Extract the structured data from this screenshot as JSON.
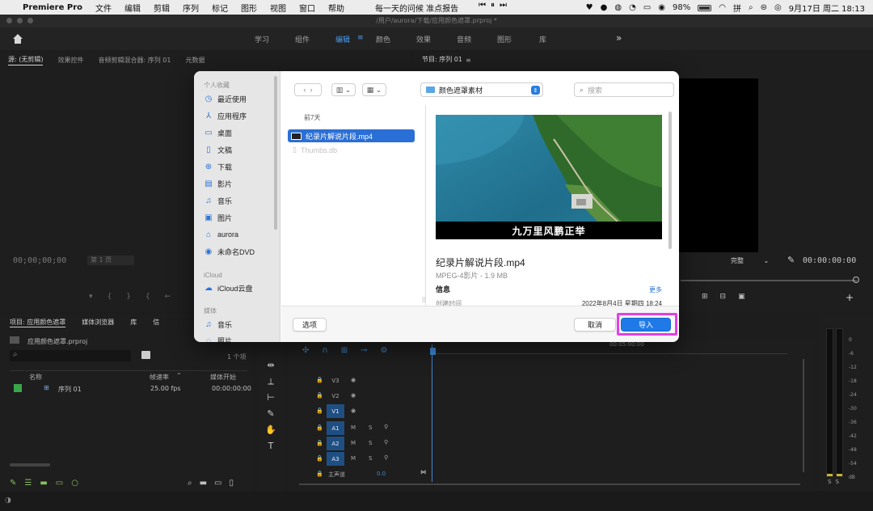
{
  "menubar": {
    "app_name": "Premiere Pro",
    "menus": [
      "文件",
      "编辑",
      "剪辑",
      "序列",
      "标记",
      "图形",
      "视图",
      "窗口",
      "帮助"
    ],
    "center_text": "每一天的问候 准点报告",
    "battery_percent": "98%",
    "input_method": "拼",
    "datetime": "9月17日 周二 18:13",
    "battery_level": 0.98
  },
  "window": {
    "path": "/用户/aurora/下载/应用颜色遮罩.prproj *"
  },
  "workspaces": {
    "items": [
      "学习",
      "组件",
      "编辑",
      "颜色",
      "效果",
      "音频",
      "图形",
      "库"
    ],
    "active": "编辑",
    "more": "»"
  },
  "source_panel": {
    "tabs": [
      "源: (无剪辑)",
      "效果控件",
      "音频剪辑混合器: 序列 01",
      "元数据"
    ],
    "timecode": "00;00;00;00",
    "page": "第 1 页"
  },
  "program_panel": {
    "title": "节目: 序列 01",
    "fit": "完整",
    "timecode": "00:00:00:00"
  },
  "project_panel": {
    "tabs": [
      "项目: 应用颜色遮罩",
      "媒体浏览器",
      "库",
      "信"
    ],
    "file": "应用颜色遮罩.prproj",
    "count": "1 个项",
    "columns": [
      "名称",
      "帧速率",
      "媒体开始"
    ],
    "rows": [
      {
        "name": "序列 01",
        "fps": "25.00 fps",
        "start": "00:00:00:00"
      }
    ]
  },
  "timeline": {
    "ruler_mark": "00:05:00:00",
    "tracks": [
      {
        "name": "V3",
        "active": false
      },
      {
        "name": "V2",
        "active": false
      },
      {
        "name": "V1",
        "active": true
      },
      {
        "name": "A1",
        "active": true
      },
      {
        "name": "A2",
        "active": true
      },
      {
        "name": "A3",
        "active": true
      }
    ],
    "master_label": "主声道",
    "master_value": "0.0"
  },
  "meter": {
    "scale": [
      "0",
      "-6",
      "-12",
      "-18",
      "-24",
      "-30",
      "-36",
      "-42",
      "-48",
      "-54",
      "dB"
    ],
    "solo": [
      "S",
      "S"
    ]
  },
  "dialog": {
    "sidebar": {
      "favorites_heading": "个人收藏",
      "favorites": [
        {
          "icon": "clock-icon",
          "label": "最近使用"
        },
        {
          "icon": "apps-icon",
          "label": "应用程序"
        },
        {
          "icon": "desktop-icon",
          "label": "桌面"
        },
        {
          "icon": "document-icon",
          "label": "文稿"
        },
        {
          "icon": "download-icon",
          "label": "下载"
        },
        {
          "icon": "film-icon",
          "label": "影片"
        },
        {
          "icon": "music-icon",
          "label": "音乐"
        },
        {
          "icon": "photo-icon",
          "label": "图片"
        },
        {
          "icon": "home-icon",
          "label": "aurora"
        },
        {
          "icon": "disc-icon",
          "label": "未命名DVD"
        }
      ],
      "icloud_heading": "iCloud",
      "icloud": [
        {
          "icon": "cloud-icon",
          "label": "iCloud云盘"
        }
      ],
      "media_heading": "媒体",
      "media": [
        {
          "icon": "music-icon",
          "label": "音乐"
        },
        {
          "icon": "camera-icon",
          "label": "照片"
        }
      ]
    },
    "location": "颜色遮罩素材",
    "search_placeholder": "搜索",
    "list_heading": "前7天",
    "files": [
      {
        "name": "纪录片解说片段.mp4",
        "selected": true
      },
      {
        "name": "Thumbs.db",
        "selected": false
      }
    ],
    "preview": {
      "caption": "九万里风鹏正举",
      "name": "纪录片解说片段.mp4",
      "kind": "MPEG-4影片 - 1.9 MB",
      "info_heading": "信息",
      "more": "更多",
      "created_label": "创建时间",
      "created_value": "2022年8月4日 星期四 18:24"
    },
    "buttons": {
      "options": "选项",
      "cancel": "取消",
      "import": "导入"
    }
  },
  "colors": {
    "accent": "#1f7ae8",
    "highlight": "#e23fe6",
    "selection": "#2a6fd6",
    "track_active": "#1f4f82"
  }
}
